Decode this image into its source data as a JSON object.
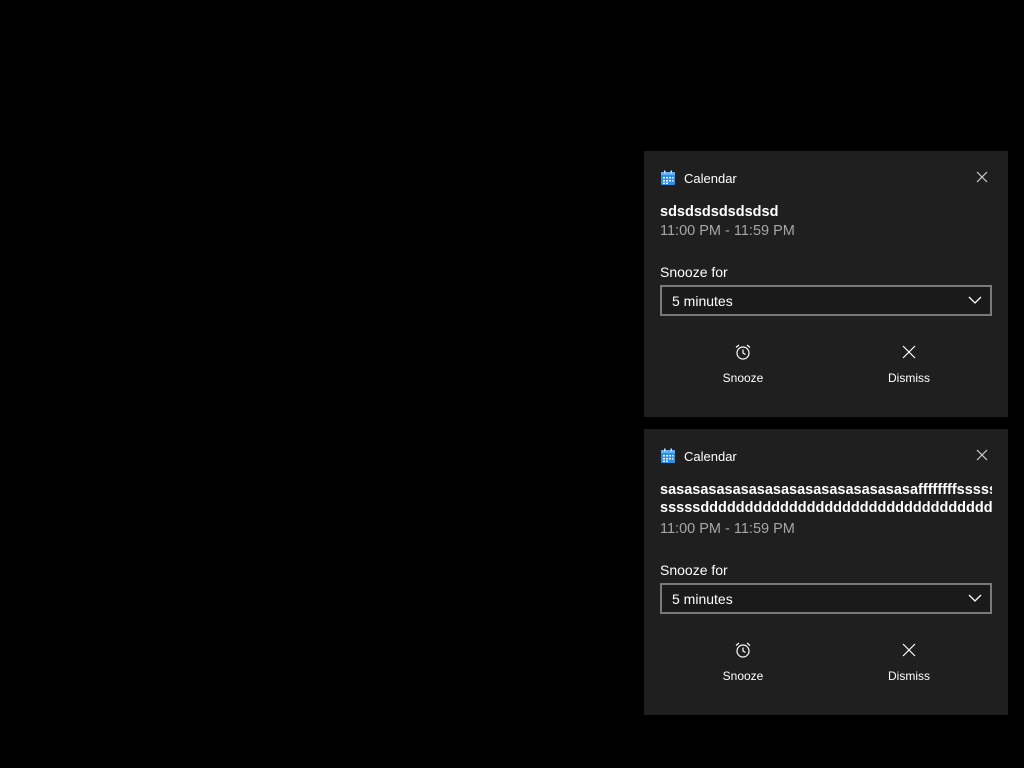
{
  "notifications": [
    {
      "app_name": "Calendar",
      "icon": "calendar-icon",
      "title_lines": [
        "sdsdsdsdsdsdsd"
      ],
      "time": "11:00 PM - 11:59 PM",
      "snooze_label": "Snooze for",
      "snooze_value": "5 minutes",
      "actions": [
        {
          "label": "Snooze",
          "icon": "alarm-clock-icon"
        },
        {
          "label": "Dismiss",
          "icon": "close-icon"
        }
      ]
    },
    {
      "app_name": "Calendar",
      "icon": "calendar-icon",
      "title_lines": [
        "sasasasasasasasasasasasasasasasaffffffffsssssssss",
        "sssssdddddddddddddddddddddddddddddddddddd"
      ],
      "time": "11:00 PM - 11:59 PM",
      "snooze_label": "Snooze for",
      "snooze_value": "5 minutes",
      "actions": [
        {
          "label": "Snooze",
          "icon": "alarm-clock-icon"
        },
        {
          "label": "Dismiss",
          "icon": "close-icon"
        }
      ]
    }
  ],
  "colors": {
    "background": "#000000",
    "toast_background": "#1f1f1f",
    "secondary_text": "#a6a6a6",
    "calendar_accent": "#2f8fe3"
  }
}
